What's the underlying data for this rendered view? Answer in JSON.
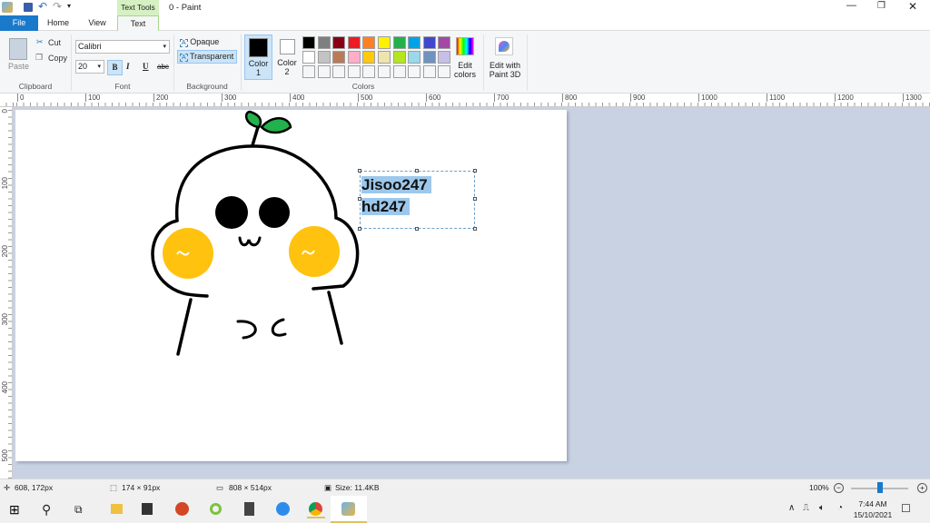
{
  "title_bar": {
    "title": "0 - Paint",
    "context_tab": "Text Tools"
  },
  "tabs": [
    {
      "label": "File"
    },
    {
      "label": "Home"
    },
    {
      "label": "View"
    },
    {
      "label": "Text"
    }
  ],
  "clipboard": {
    "paste": "Paste",
    "cut": "Cut",
    "copy": "Copy",
    "group": "Clipboard"
  },
  "font": {
    "family": "Calibri",
    "size": "20",
    "bold": "B",
    "italic": "I",
    "underline": "U",
    "strike": "abc",
    "group": "Font",
    "bold_active": true
  },
  "background": {
    "opaque": "Opaque",
    "transparent": "Transparent",
    "group": "Background",
    "selected": "Transparent"
  },
  "colors": {
    "color1": "Color",
    "color1_n": "1",
    "color2": "Color",
    "color2_n": "2",
    "color1_value": "#000000",
    "color2_value": "#ffffff",
    "group": "Colors",
    "edit_colors_1": "Edit",
    "edit_colors_2": "colors",
    "palette": [
      [
        "#000000",
        "#7f7f7f",
        "#880015",
        "#ed1c24",
        "#ff7f27",
        "#fff200",
        "#22b14c",
        "#00a2e8",
        "#3f48cc",
        "#a349a4"
      ],
      [
        "#ffffff",
        "#c3c3c3",
        "#b97a57",
        "#ffaec9",
        "#ffc90e",
        "#efe4b0",
        "#b5e61d",
        "#99d9ea",
        "#7092be",
        "#c8bfe7"
      ]
    ]
  },
  "paint3d": {
    "line1": "Edit with",
    "line2": "Paint 3D"
  },
  "ruler": {
    "h": [
      "0",
      "100",
      "200",
      "300",
      "400",
      "500",
      "600",
      "700",
      "800",
      "900",
      "1000",
      "1100",
      "1200",
      "1300"
    ],
    "v": [
      "0",
      "100",
      "200",
      "300",
      "400",
      "500"
    ]
  },
  "canvas_text": {
    "line1": "Jisoo247",
    "line2": "hd247"
  },
  "status": {
    "cursor": "608, 172px",
    "selection": "174 × 91px",
    "canvas_size": "808 × 514px",
    "file_size": "Size: 11.4KB",
    "zoom": "100%",
    "zoom_percent": 100
  },
  "taskbar": {
    "time": "7:44 AM",
    "date": "15/10/2021"
  }
}
